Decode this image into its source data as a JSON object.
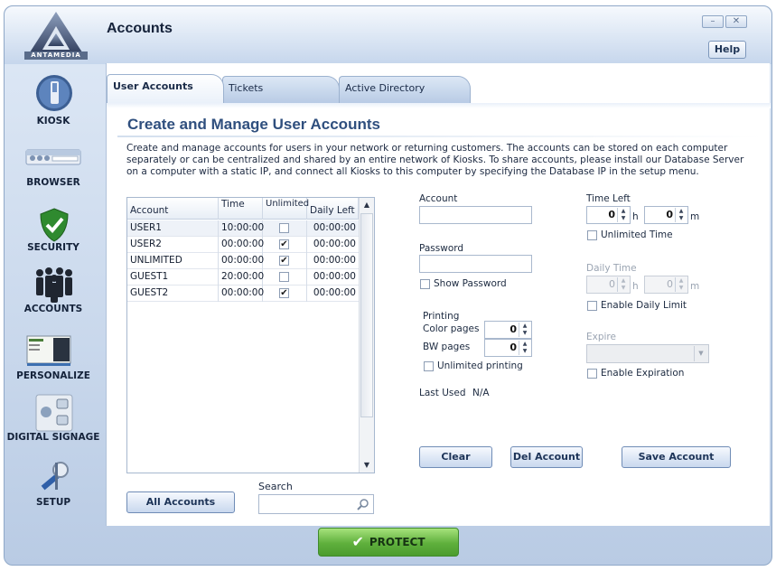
{
  "app": {
    "title": "Accounts",
    "logo_text": "ANTAMEDIA",
    "help_label": "Help",
    "minimize_label": "–",
    "close_label": "✕"
  },
  "sidebar": {
    "items": [
      {
        "label": "KIOSK",
        "icon": "kiosk-icon"
      },
      {
        "label": "BROWSER",
        "icon": "browser-icon"
      },
      {
        "label": "SECURITY",
        "icon": "security-shield-icon"
      },
      {
        "label": "ACCOUNTS",
        "icon": "accounts-people-icon"
      },
      {
        "label": "PERSONALIZE",
        "icon": "personalize-icon"
      },
      {
        "label": "DIGITAL SIGNAGE",
        "icon": "digital-signage-icon"
      },
      {
        "label": "SETUP",
        "icon": "setup-icon"
      }
    ]
  },
  "tabs": [
    {
      "label": "User Accounts",
      "active": true
    },
    {
      "label": "Tickets",
      "active": false
    },
    {
      "label": "Active Directory",
      "active": false
    }
  ],
  "main": {
    "heading": "Create and Manage User Accounts",
    "description": "Create and manage accounts for users in your network or returning customers. The accounts can be stored on each computer separately or can be centralized and shared by an entire network of Kiosks. To share accounts, please install our Database Server on a computer with a static IP, and connect all Kiosks to this computer by specifying the Database IP in the setup menu."
  },
  "table": {
    "columns": [
      "Account",
      "Time",
      "Unlimited",
      "Daily Left"
    ],
    "rows": [
      {
        "account": "USER1",
        "time": "10:00:00",
        "unlimited": false,
        "daily_left": "00:00:00"
      },
      {
        "account": "USER2",
        "time": "00:00:00",
        "unlimited": true,
        "daily_left": "00:00:00"
      },
      {
        "account": "UNLIMITED",
        "time": "00:00:00",
        "unlimited": true,
        "daily_left": "00:00:00"
      },
      {
        "account": "GUEST1",
        "time": "20:00:00",
        "unlimited": false,
        "daily_left": "00:00:00"
      },
      {
        "account": "GUEST2",
        "time": "00:00:00",
        "unlimited": true,
        "daily_left": "00:00:00"
      }
    ]
  },
  "search": {
    "label": "Search",
    "value": ""
  },
  "buttons": {
    "all_accounts": "All Accounts",
    "clear": "Clear",
    "del_account": "Del Account",
    "save_account": "Save Account",
    "protect": "PROTECT"
  },
  "form": {
    "account_label": "Account",
    "account_value": "",
    "password_label": "Password",
    "password_value": "",
    "show_password_label": "Show Password",
    "printing_label": "Printing",
    "color_pages_label": "Color pages",
    "color_pages_value": "0",
    "bw_pages_label": "BW pages",
    "bw_pages_value": "0",
    "unlimited_printing_label": "Unlimited printing",
    "last_used_label": "Last Used",
    "last_used_value": "N/A",
    "time_left_label": "Time Left",
    "time_left_hours": "0",
    "time_left_minutes": "0",
    "hours_unit": "h",
    "minutes_unit": "m",
    "unlimited_time_label": "Unlimited Time",
    "daily_time_label": "Daily Time",
    "daily_time_hours": "0",
    "daily_time_minutes": "0",
    "enable_daily_limit_label": "Enable Daily Limit",
    "expire_label": "Expire",
    "expire_value": "",
    "enable_expiration_label": "Enable Expiration"
  }
}
